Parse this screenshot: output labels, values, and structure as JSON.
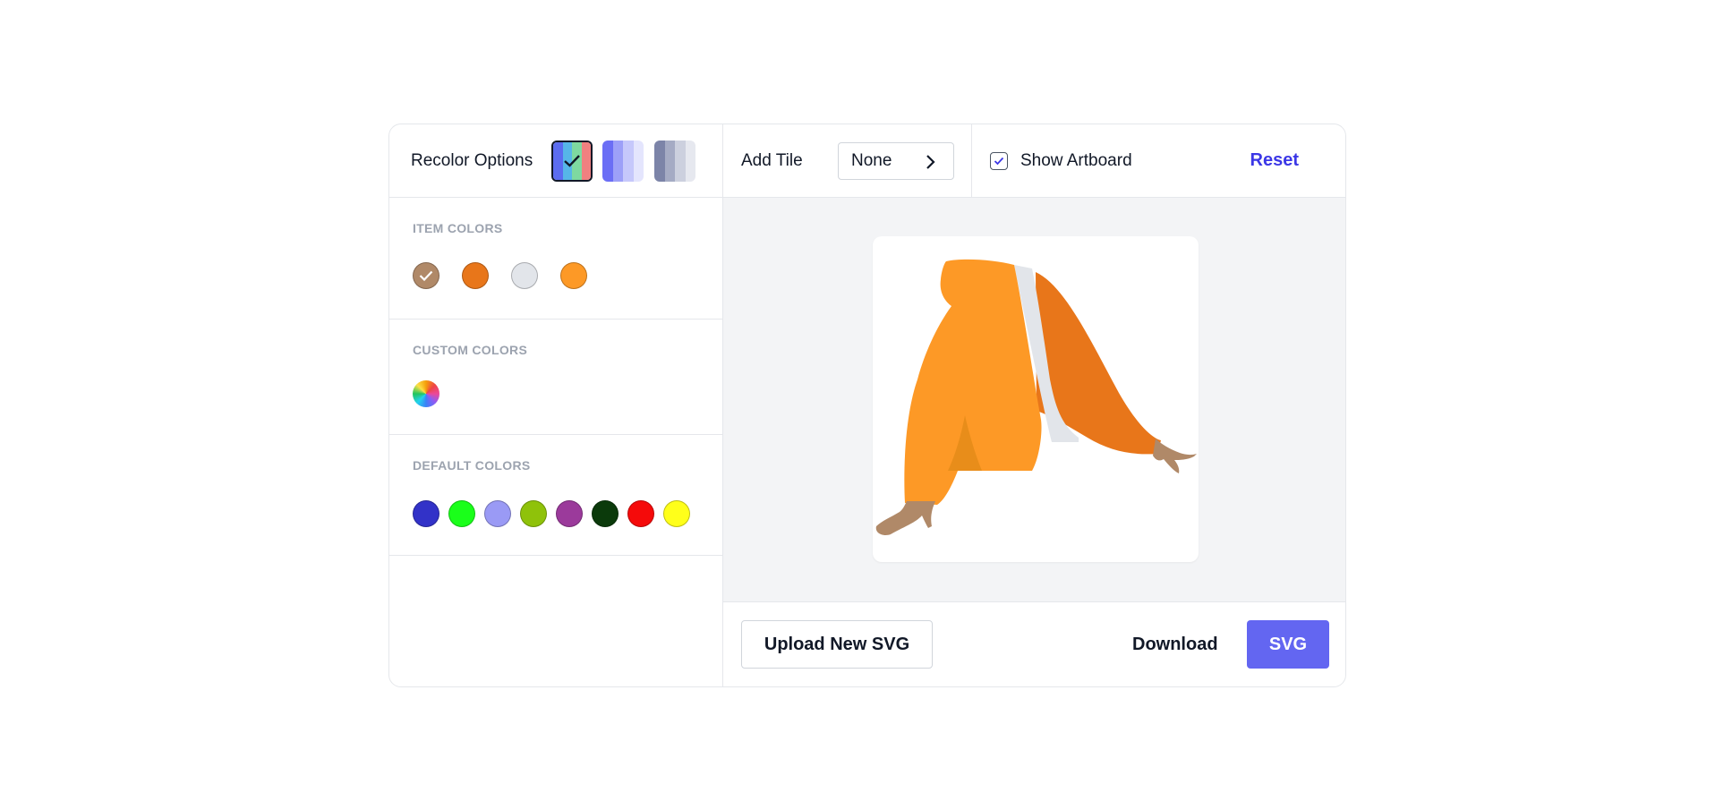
{
  "toolbar": {
    "recolor_label": "Recolor Options",
    "palettes": [
      {
        "name": "multicolor",
        "colors": [
          "#5b6cf0",
          "#56b6e8",
          "#7ed9a0",
          "#f08080"
        ],
        "selected": true
      },
      {
        "name": "purple-shades",
        "colors": [
          "#6b6ef5",
          "#9da0f8",
          "#c6c8fb",
          "#e4e5fd"
        ],
        "selected": false
      },
      {
        "name": "slate-shades",
        "colors": [
          "#7c84a8",
          "#a5abc4",
          "#ccd0de",
          "#e6e8ef"
        ],
        "selected": false
      }
    ],
    "add_tile_label": "Add Tile",
    "tile_value": "None",
    "show_artboard_label": "Show Artboard",
    "show_artboard_checked": true,
    "reset_label": "Reset"
  },
  "sidebar": {
    "item_colors_title": "ITEM COLORS",
    "item_colors": [
      "#b08968",
      "#e8761a",
      "#e2e5ea",
      "#fd9926"
    ],
    "custom_colors_title": "CUSTOM COLORS",
    "default_colors_title": "DEFAULT COLORS",
    "default_colors": [
      "#3232c8",
      "#1aff1a",
      "#9a9af5",
      "#8fc20a",
      "#9b3a9b",
      "#0b3a0b",
      "#f50a0a",
      "#ffff1a"
    ]
  },
  "footer": {
    "upload_label": "Upload New SVG",
    "download_label": "Download",
    "format_label": "SVG"
  },
  "artwork": {
    "colors": {
      "skin": "#b08968",
      "dark_orange": "#e8761a",
      "shirt": "#e2e5ea",
      "orange": "#fd9926",
      "shade": "#e88d1a"
    }
  }
}
